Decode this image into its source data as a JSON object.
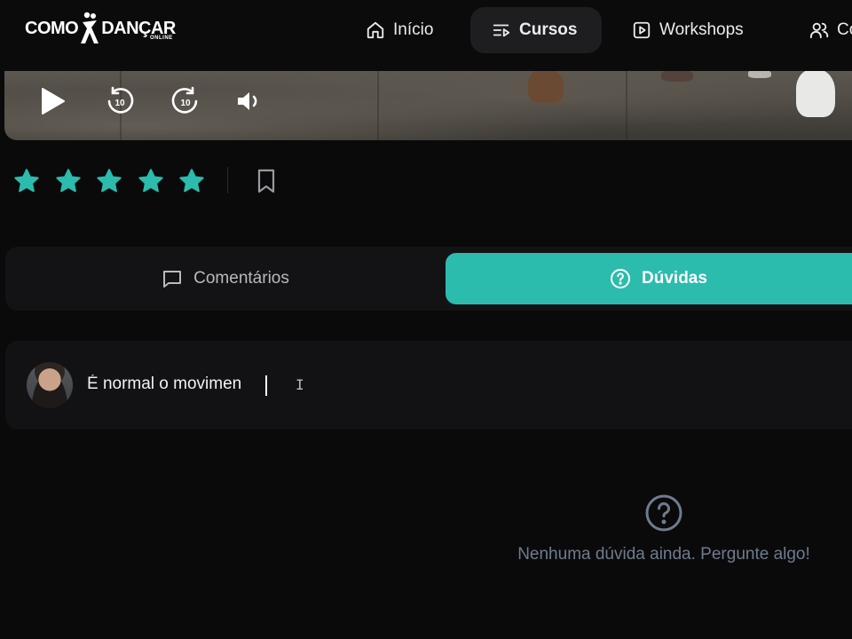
{
  "brand": {
    "logo_left": "COMO",
    "logo_right": "DANÇAR",
    "logo_sub": "ONLINE"
  },
  "nav": {
    "items": [
      {
        "id": "inicio",
        "label": "Início",
        "icon": "home-icon",
        "active": false
      },
      {
        "id": "cursos",
        "label": "Cursos",
        "icon": "course-list-icon",
        "active": true
      },
      {
        "id": "workshops",
        "label": "Workshops",
        "icon": "video-play-icon",
        "active": false
      },
      {
        "id": "comunidade",
        "label": "Co",
        "icon": "users-icon",
        "active": false
      }
    ]
  },
  "player": {
    "controls": [
      "play-icon",
      "rewind-10-icon",
      "forward-10-icon",
      "volume-icon"
    ],
    "rewind_label": "10",
    "forward_label": "10"
  },
  "rating": {
    "stars_filled": 5,
    "stars_total": 5,
    "star_color": "#2bbcad"
  },
  "tabs": [
    {
      "id": "comentarios",
      "label": "Comentários",
      "icon": "comment-icon",
      "active": false
    },
    {
      "id": "duvidas",
      "label": "Dúvidas",
      "icon": "question-circle-icon",
      "active": true
    }
  ],
  "composer": {
    "value": "É normal o movimen"
  },
  "empty_state": {
    "icon": "question-circle-icon",
    "message": "Nenhuma dúvida ainda. Pergunte algo!"
  },
  "colors": {
    "accent": "#2bbcad",
    "background": "#0a0a0b",
    "muted_text": "#6f7b8d"
  }
}
